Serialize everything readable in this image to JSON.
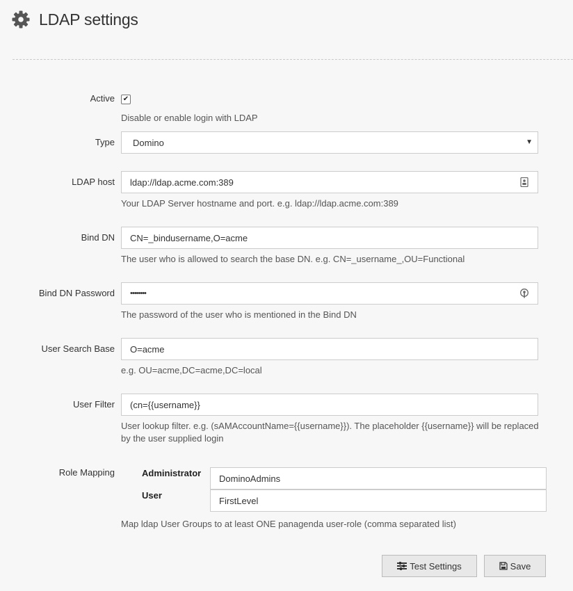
{
  "header": {
    "title": "LDAP settings",
    "icon": "gear-icon"
  },
  "fields": {
    "active": {
      "label": "Active",
      "checked": true,
      "check_glyph": "✔",
      "help": "Disable or enable login with LDAP"
    },
    "type": {
      "label": "Type",
      "value": "Domino"
    },
    "ldap_host": {
      "label": "LDAP host",
      "value": "ldap://ldap.acme.com:389",
      "help": "Your LDAP Server hostname and port. e.g. ldap://ldap.acme.com:389"
    },
    "bind_dn": {
      "label": "Bind DN",
      "value": "CN=_bindusername,O=acme",
      "help": "The user who is allowed to search the base DN. e.g. CN=_username_,OU=Functional"
    },
    "bind_dn_password": {
      "label": "Bind DN Password",
      "value": "••••••••",
      "help": "The password of the user who is mentioned in the Bind DN"
    },
    "user_search_base": {
      "label": "User Search Base",
      "value": "O=acme",
      "help": "e.g. OU=acme,DC=acme,DC=local"
    },
    "user_filter": {
      "label": "User Filter",
      "value": "(cn={{username}}",
      "help": "User lookup filter. e.g. (sAMAccountName={{username}}). The placeholder {{username}} will be replaced by the user supplied login"
    }
  },
  "role_mapping": {
    "label": "Role Mapping",
    "roles": [
      {
        "name": "Administrator",
        "value": "DominoAdmins"
      },
      {
        "name": "User",
        "value": "FirstLevel"
      }
    ],
    "help": "Map ldap User Groups to at least ONE panagenda user-role (comma separated list)"
  },
  "buttons": {
    "test_settings": "Test Settings",
    "save": "Save"
  }
}
